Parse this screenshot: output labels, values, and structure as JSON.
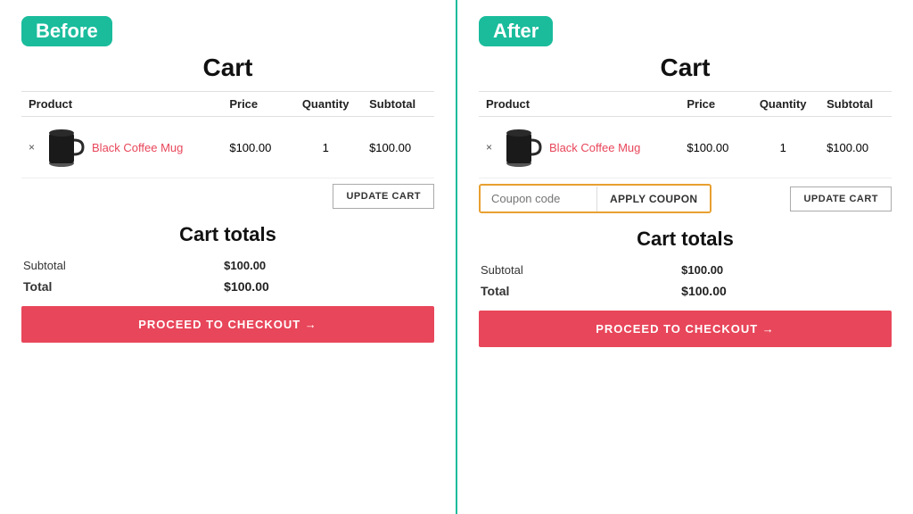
{
  "before": {
    "badge": "Before",
    "cart_title": "Cart",
    "table": {
      "headers": [
        "Product",
        "Price",
        "Quantity",
        "Subtotal"
      ],
      "row": {
        "remove": "×",
        "product_name": "Black Coffee Mug",
        "price": "$100.00",
        "quantity": "1",
        "subtotal": "$100.00"
      }
    },
    "update_cart_label": "UPDATE CART",
    "cart_totals_title": "Cart totals",
    "subtotal_label": "Subtotal",
    "subtotal_value": "$100.00",
    "total_label": "Total",
    "total_value": "$100.00",
    "checkout_btn": "PROCEED TO CHECKOUT →"
  },
  "after": {
    "badge": "After",
    "cart_title": "Cart",
    "table": {
      "headers": [
        "Product",
        "Price",
        "Quantity",
        "Subtotal"
      ],
      "row": {
        "remove": "×",
        "product_name": "Black Coffee Mug",
        "price": "$100.00",
        "quantity": "1",
        "subtotal": "$100.00"
      }
    },
    "coupon_placeholder": "Coupon code",
    "apply_coupon_label": "APPLY COUPON",
    "update_cart_label": "UPDATE CART",
    "cart_totals_title": "Cart totals",
    "subtotal_label": "Subtotal",
    "subtotal_value": "$100.00",
    "total_label": "Total",
    "total_value": "$100.00",
    "checkout_btn": "PROCEED TO CHECKOUT →"
  },
  "accent_color": "#1abc9c",
  "checkout_btn_color": "#e8465a",
  "coupon_border_color": "#e8a030"
}
